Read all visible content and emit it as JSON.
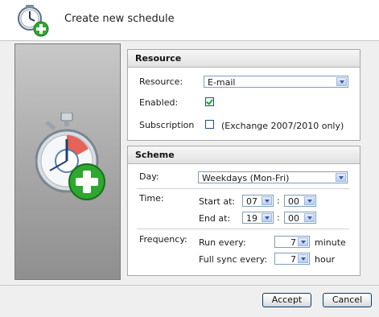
{
  "dialog": {
    "title": "Create new schedule"
  },
  "resource": {
    "header": "Resource",
    "resource_label": "Resource:",
    "resource_value": "E-mail",
    "enabled_label": "Enabled:",
    "enabled": true,
    "subscription_label": "Subscription",
    "subscription_checked": false,
    "subscription_note": "(Exchange 2007/2010 only)"
  },
  "scheme": {
    "header": "Scheme",
    "day_label": "Day:",
    "day_value": "Weekdays (Mon-Fri)",
    "time_label": "Time:",
    "start_label": "Start at:",
    "start_hour": "07",
    "start_minute": "00",
    "end_label": "End at:",
    "end_hour": "19",
    "end_minute": "00",
    "time_separator": ":",
    "frequency_label": "Frequency:",
    "run_every_label": "Run every:",
    "run_every_value": "7",
    "run_every_unit": "minute",
    "full_sync_label": "Full sync every:",
    "full_sync_value": "7",
    "full_sync_unit": "hour"
  },
  "buttons": {
    "accept": "Accept",
    "cancel": "Cancel"
  },
  "icons": {
    "title": "clock-add-icon",
    "hero": "stopwatch-add-icon"
  },
  "colors": {
    "check": "#21a121",
    "plus_green": "#2ea82e",
    "accent_blue": "#3b5a9a"
  }
}
